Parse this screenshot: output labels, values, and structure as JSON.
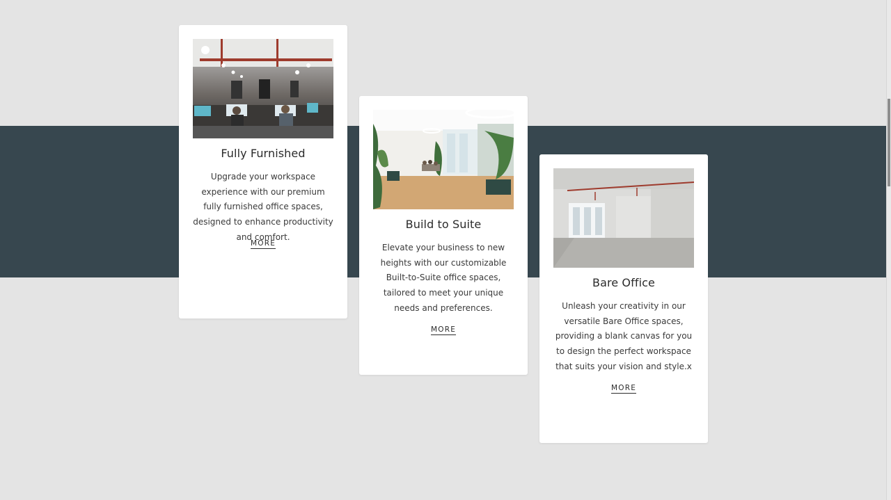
{
  "cards": [
    {
      "title": "Fully Furnished",
      "description": "Upgrade your workspace experience with our premium fully furnished office spaces, designed to enhance productivity and comfort.",
      "more_label": "MORE",
      "image_alt": "office-with-desks-photo"
    },
    {
      "title": "Build to Suite",
      "description": "Elevate your business to new heights with our customizable Built-to-Suite office spaces, tailored to meet your unique needs and preferences.",
      "more_label": "MORE",
      "image_alt": "bright-lounge-with-plants-photo"
    },
    {
      "title": "Bare Office",
      "description": "Unleash your creativity in our versatile Bare Office spaces, providing a blank canvas for you to design the perfect workspace that suits your vision and style.x",
      "more_label": "MORE",
      "image_alt": "empty-office-room-photo"
    }
  ],
  "colors": {
    "page_background": "#e4e4e4",
    "band": "#37474f",
    "card": "#ffffff"
  }
}
